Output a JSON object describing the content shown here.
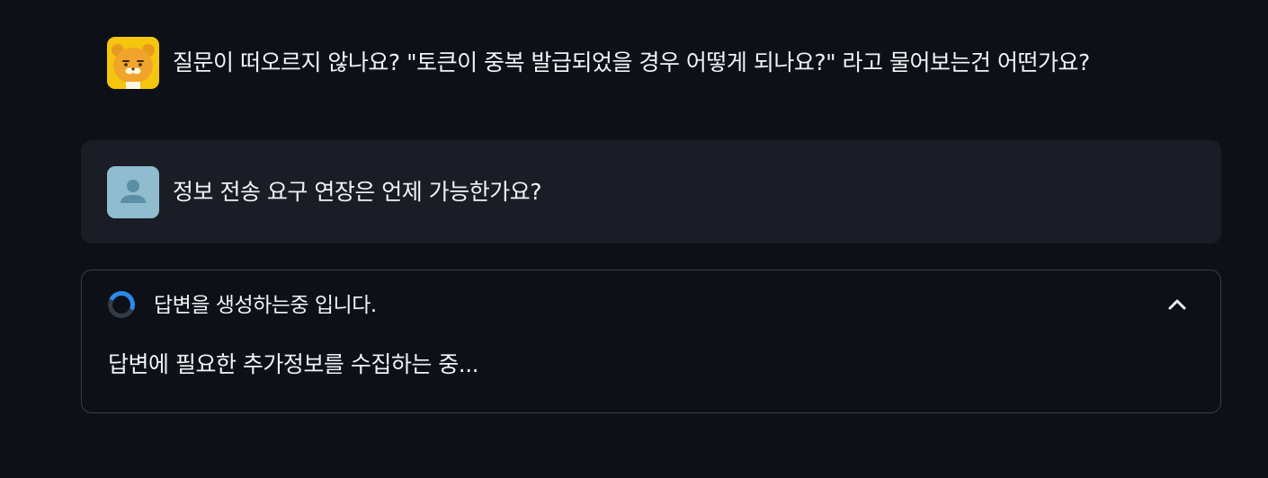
{
  "chat": {
    "assistant_message": {
      "avatar_icon": "ryan-bear-icon",
      "text": "질문이 떠오르지 않나요? \"토큰이 중복 발급되었을 경우 어떻게 되나요?\" 라고 물어보는건 어떤가요?"
    },
    "user_message": {
      "avatar_icon": "user-icon",
      "text": "정보 전송 요구 연장은 언제 가능한가요?"
    },
    "status": {
      "label": "답변을 생성하는중 입니다.",
      "detail": "답변에 필요한 추가정보를 수집하는 중...",
      "collapse_icon": "chevron-up-icon",
      "spinner_color": "#2b8bea"
    }
  },
  "colors": {
    "background": "#0e1017",
    "user_bubble": "#1b1d26",
    "bot_avatar": "#f5c60e",
    "user_avatar": "#8fbccf"
  }
}
